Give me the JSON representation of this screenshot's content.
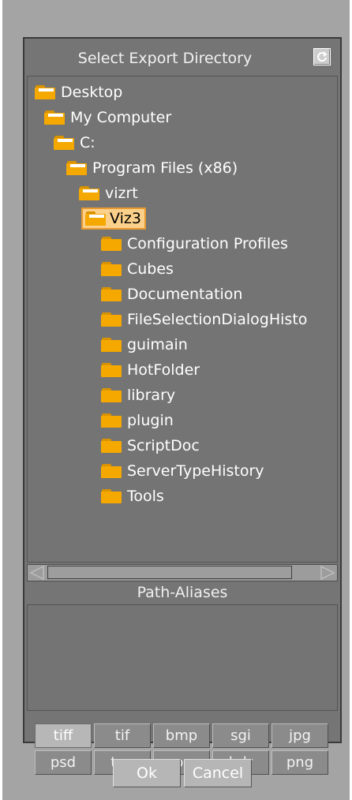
{
  "dialog": {
    "title": "Select Export Directory",
    "refresh_icon": "refresh-icon"
  },
  "tree": [
    {
      "label": "Desktop",
      "depth": 0,
      "icon": "folder-open-icon"
    },
    {
      "label": "My Computer",
      "depth": 1,
      "icon": "folder-open-icon"
    },
    {
      "label": "C:",
      "depth": 2,
      "icon": "folder-open-icon"
    },
    {
      "label": "Program Files (x86)",
      "depth": 3,
      "icon": "folder-open-icon"
    },
    {
      "label": "vizrt",
      "depth": 4,
      "icon": "folder-open-icon"
    },
    {
      "label": "Viz3",
      "depth": 5,
      "icon": "folder-open-icon",
      "selected": true
    },
    {
      "label": "Configuration Profiles",
      "depth": 6,
      "icon": "folder-icon"
    },
    {
      "label": "Cubes",
      "depth": 6,
      "icon": "folder-icon"
    },
    {
      "label": "Documentation",
      "depth": 6,
      "icon": "folder-icon"
    },
    {
      "label": "FileSelectionDialogHisto",
      "depth": 6,
      "icon": "folder-icon"
    },
    {
      "label": "guimain",
      "depth": 6,
      "icon": "folder-icon"
    },
    {
      "label": "HotFolder",
      "depth": 6,
      "icon": "folder-icon"
    },
    {
      "label": "library",
      "depth": 6,
      "icon": "folder-icon"
    },
    {
      "label": "plugin",
      "depth": 6,
      "icon": "folder-icon"
    },
    {
      "label": "ScriptDoc",
      "depth": 6,
      "icon": "folder-icon"
    },
    {
      "label": "ServerTypeHistory",
      "depth": 6,
      "icon": "folder-icon"
    },
    {
      "label": "Tools",
      "depth": 6,
      "icon": "folder-icon"
    }
  ],
  "path_aliases": {
    "header": "Path-Aliases"
  },
  "formats": [
    "tiff",
    "tif",
    "bmp",
    "sgi",
    "jpg",
    "psd",
    "tga",
    "xpm",
    "hdr",
    "png"
  ],
  "active_format": "tiff",
  "buttons": {
    "ok": "Ok",
    "cancel": "Cancel"
  },
  "colors": {
    "folder": "#f5a800",
    "selection": "#fbd08a"
  }
}
